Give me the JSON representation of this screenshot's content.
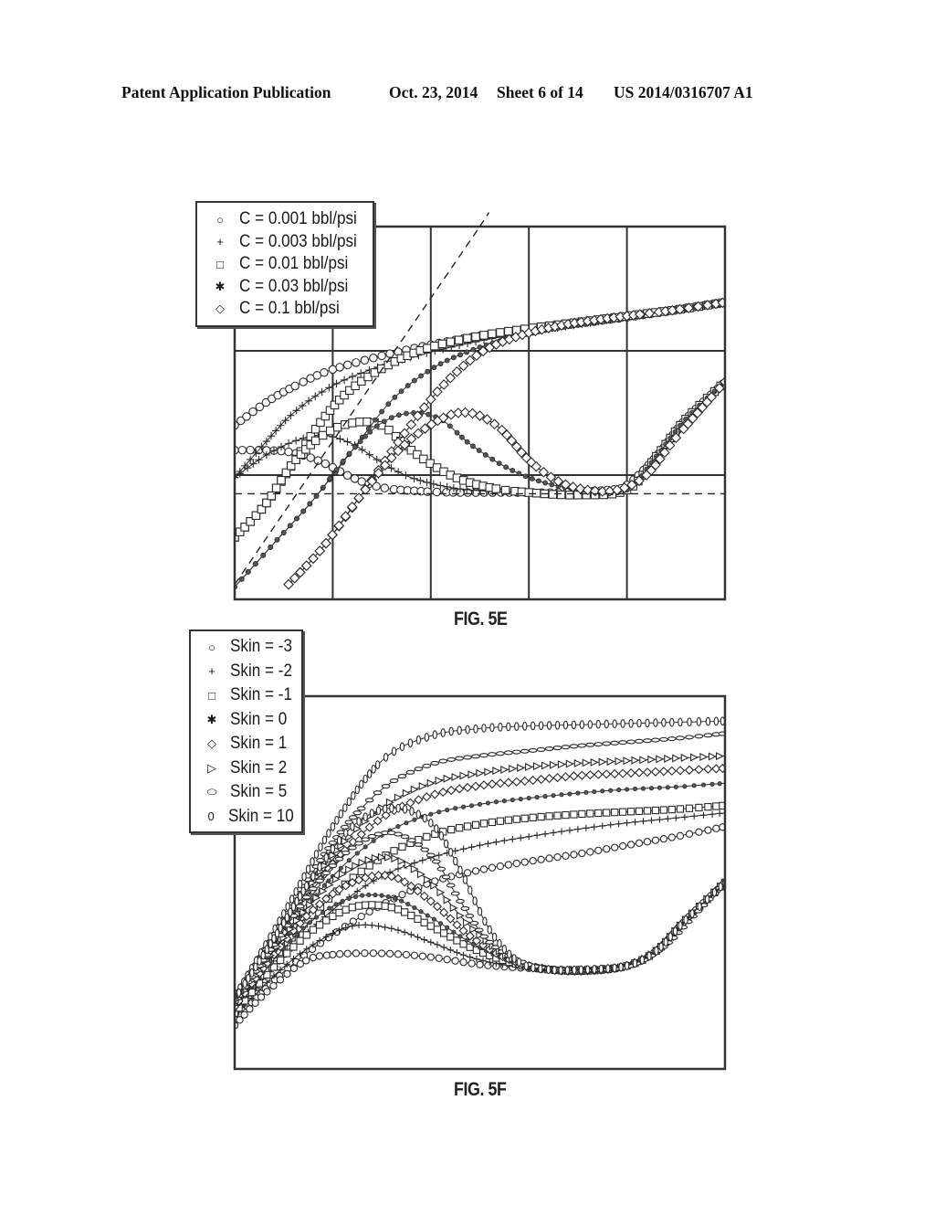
{
  "header": {
    "publication": "Patent Application Publication",
    "date": "Oct. 23, 2014",
    "sheet": "Sheet 6 of 14",
    "number": "US 2014/0316707 A1"
  },
  "figures": [
    {
      "id": "fig5e",
      "label": "FIG. 5E"
    },
    {
      "id": "fig5f",
      "label": "FIG. 5F"
    }
  ],
  "chart_data": [
    {
      "type": "line",
      "title": "FIG. 5E",
      "xlabel": "",
      "ylabel": "",
      "x_scale": "log (unlabeled decades)",
      "xlim": [
        0,
        5
      ],
      "ylim": [
        0,
        3
      ],
      "grid": true,
      "legend_position": "top-left (outside, overlapping frame)",
      "legend": [
        {
          "symbol": "circle",
          "glyph": "○",
          "label": "C = 0.001 bbl/psi"
        },
        {
          "symbol": "plus",
          "glyph": "+",
          "label": "C = 0.003 bbl/psi"
        },
        {
          "symbol": "square",
          "glyph": "□",
          "label": "C = 0.01 bbl/psi"
        },
        {
          "symbol": "asterisk",
          "glyph": "✱",
          "label": "C = 0.03 bbl/psi"
        },
        {
          "symbol": "diamond",
          "glyph": "◇",
          "label": "C = 0.1 bbl/psi"
        }
      ],
      "reference_lines": [
        {
          "name": "unit-slope",
          "style": "dashed",
          "points": [
            [
              0,
              0.12
            ],
            [
              2.5,
              3.0
            ]
          ]
        },
        {
          "name": "radial-flow-stabilization",
          "style": "dashed",
          "points": [
            [
              0.0,
              0.85
            ],
            [
              5,
              0.85
            ]
          ]
        }
      ],
      "series": [
        {
          "name": "C = 0.001 bbl/psi (pressure)",
          "marker": "circle",
          "x": [
            0,
            0.35,
            0.7,
            1.0,
            1.5,
            2.0,
            2.5,
            3.0,
            3.5,
            4.0,
            4.5,
            5.0
          ],
          "y": [
            1.4,
            1.6,
            1.75,
            1.85,
            1.96,
            2.05,
            2.12,
            2.17,
            2.22,
            2.27,
            2.33,
            2.39
          ]
        },
        {
          "name": "C = 0.001 bbl/psi (derivative)",
          "marker": "circle",
          "x": [
            0,
            0.3,
            0.6,
            0.9,
            1.2,
            1.5,
            1.9,
            2.3,
            2.8,
            3.3,
            3.8,
            4.0,
            4.3,
            4.6,
            5.0
          ],
          "y": [
            1.2,
            1.2,
            1.18,
            1.1,
            0.98,
            0.9,
            0.87,
            0.86,
            0.86,
            0.86,
            0.88,
            0.92,
            1.15,
            1.45,
            1.75
          ]
        },
        {
          "name": "C = 0.003 bbl/psi (pressure)",
          "marker": "plus",
          "x": [
            0,
            0.3,
            0.6,
            1.0,
            1.5,
            2.0,
            2.5,
            3.0,
            3.5,
            4.0,
            4.5,
            5.0
          ],
          "y": [
            0.98,
            1.25,
            1.5,
            1.72,
            1.88,
            1.99,
            2.08,
            2.15,
            2.21,
            2.27,
            2.33,
            2.39
          ]
        },
        {
          "name": "C = 0.003 bbl/psi (derivative)",
          "marker": "plus",
          "x": [
            0,
            0.3,
            0.6,
            0.9,
            1.2,
            1.5,
            1.8,
            2.2,
            2.6,
            3.0,
            3.5,
            4.0,
            4.3,
            4.6,
            5.0
          ],
          "y": [
            0.98,
            1.15,
            1.27,
            1.32,
            1.25,
            1.1,
            0.98,
            0.9,
            0.87,
            0.86,
            0.86,
            0.9,
            1.15,
            1.45,
            1.75
          ]
        },
        {
          "name": "C = 0.01 bbl/psi (pressure)",
          "marker": "square",
          "x": [
            0,
            0.3,
            0.6,
            0.9,
            1.2,
            1.6,
            2.0,
            2.5,
            3.0,
            3.5,
            4.0,
            4.5,
            5.0
          ],
          "y": [
            0.5,
            0.75,
            1.1,
            1.45,
            1.7,
            1.9,
            2.03,
            2.12,
            2.18,
            2.23,
            2.28,
            2.33,
            2.39
          ]
        },
        {
          "name": "C = 0.01 bbl/psi (derivative)",
          "marker": "square",
          "x": [
            0,
            0.3,
            0.6,
            0.9,
            1.2,
            1.5,
            1.8,
            2.2,
            2.6,
            3.0,
            3.5,
            4.0,
            4.3,
            4.6,
            5.0
          ],
          "y": [
            0.5,
            0.75,
            1.1,
            1.32,
            1.42,
            1.4,
            1.2,
            1.0,
            0.9,
            0.86,
            0.84,
            0.88,
            1.15,
            1.45,
            1.75
          ]
        },
        {
          "name": "C = 0.03 bbl/psi (pressure)",
          "marker": "asterisk",
          "x": [
            0,
            0.4,
            0.8,
            1.2,
            1.6,
            2.0,
            2.4,
            2.8,
            3.2,
            3.6,
            4.0,
            4.5,
            5.0
          ],
          "y": [
            0.1,
            0.45,
            0.8,
            1.2,
            1.6,
            1.85,
            2.0,
            2.1,
            2.17,
            2.22,
            2.27,
            2.33,
            2.39
          ]
        },
        {
          "name": "C = 0.03 bbl/psi (derivative)",
          "marker": "asterisk",
          "x": [
            0,
            0.4,
            0.8,
            1.2,
            1.5,
            1.8,
            2.1,
            2.4,
            2.8,
            3.2,
            3.6,
            4.0,
            4.3,
            4.6,
            5.0
          ],
          "y": [
            0.1,
            0.45,
            0.8,
            1.2,
            1.42,
            1.5,
            1.45,
            1.25,
            1.05,
            0.93,
            0.88,
            0.88,
            1.15,
            1.45,
            1.75
          ]
        },
        {
          "name": "C = 0.1 bbl/psi (pressure)",
          "marker": "diamond",
          "x": [
            0.55,
            0.9,
            1.3,
            1.7,
            2.1,
            2.5,
            2.9,
            3.3,
            3.7,
            4.1,
            4.5,
            5.0
          ],
          "y": [
            0.12,
            0.42,
            0.85,
            1.3,
            1.7,
            1.98,
            2.12,
            2.2,
            2.25,
            2.29,
            2.33,
            2.39
          ]
        },
        {
          "name": "C = 0.1 bbl/psi (derivative)",
          "marker": "diamond",
          "x": [
            0.55,
            0.9,
            1.3,
            1.7,
            2.1,
            2.4,
            2.7,
            3.0,
            3.3,
            3.6,
            3.9,
            4.2,
            4.5,
            5.0
          ],
          "y": [
            0.12,
            0.42,
            0.85,
            1.22,
            1.45,
            1.5,
            1.38,
            1.12,
            0.95,
            0.88,
            0.88,
            1.0,
            1.3,
            1.75
          ]
        }
      ]
    },
    {
      "type": "line",
      "title": "FIG. 5F",
      "xlabel": "",
      "ylabel": "",
      "x_scale": "log (unlabeled decades)",
      "xlim": [
        0,
        5
      ],
      "ylim": [
        0,
        3
      ],
      "grid": false,
      "legend_position": "top-left (outside, overlapping frame)",
      "legend": [
        {
          "symbol": "circle",
          "glyph": "○",
          "label": "Skin = -3"
        },
        {
          "symbol": "plus",
          "glyph": "+",
          "label": "Skin = -2"
        },
        {
          "symbol": "square",
          "glyph": "□",
          "label": "Skin = -1"
        },
        {
          "symbol": "asterisk",
          "glyph": "✱",
          "label": "Skin = 0"
        },
        {
          "symbol": "diamond",
          "glyph": "◇",
          "label": "Skin = 1"
        },
        {
          "symbol": "triangle-right",
          "glyph": "▷",
          "label": "Skin = 2"
        },
        {
          "symbol": "ellipse-horizontal",
          "glyph": "⬭",
          "label": "Skin = 5"
        },
        {
          "symbol": "ellipse-vertical",
          "glyph": "0",
          "label": "Skin = 10"
        }
      ],
      "series": [
        {
          "name": "Skin = -3 (pressure)",
          "marker": "circle",
          "x": [
            0,
            0.5,
            1.0,
            1.5,
            2.0,
            2.5,
            3.0,
            3.5,
            4.0,
            4.5,
            5.0
          ],
          "y": [
            0.4,
            0.78,
            1.08,
            1.32,
            1.5,
            1.6,
            1.67,
            1.73,
            1.8,
            1.87,
            1.95
          ]
        },
        {
          "name": "Skin = -3 (derivative)",
          "marker": "circle",
          "x": [
            0,
            0.3,
            0.7,
            1.0,
            1.5,
            2.0,
            2.5,
            3.0,
            3.5,
            4.0,
            4.3,
            4.6,
            5.0
          ],
          "y": [
            0.35,
            0.6,
            0.86,
            0.92,
            0.93,
            0.9,
            0.84,
            0.81,
            0.8,
            0.83,
            0.95,
            1.2,
            1.5
          ]
        },
        {
          "name": "Skin = -2 (pressure)",
          "marker": "plus",
          "x": [
            0,
            0.5,
            1.0,
            1.5,
            2.0,
            2.5,
            3.0,
            3.5,
            4.0,
            4.5,
            5.0
          ],
          "y": [
            0.45,
            0.9,
            1.28,
            1.55,
            1.7,
            1.8,
            1.87,
            1.93,
            1.98,
            2.02,
            2.06
          ]
        },
        {
          "name": "Skin = -2 (derivative)",
          "marker": "plus",
          "x": [
            0,
            0.4,
            0.8,
            1.2,
            1.6,
            2.0,
            2.4,
            2.8,
            3.2,
            3.6,
            4.0,
            4.3,
            4.6,
            5.0
          ],
          "y": [
            0.42,
            0.75,
            1.0,
            1.15,
            1.13,
            1.02,
            0.9,
            0.83,
            0.8,
            0.79,
            0.83,
            0.95,
            1.2,
            1.5
          ]
        },
        {
          "name": "Skin = -1 (pressure)",
          "marker": "square",
          "x": [
            0,
            0.5,
            1.0,
            1.5,
            2.0,
            2.5,
            3.0,
            3.5,
            4.0,
            4.5,
            5.0
          ],
          "y": [
            0.48,
            0.98,
            1.4,
            1.7,
            1.88,
            1.97,
            2.02,
            2.05,
            2.07,
            2.09,
            2.12
          ]
        },
        {
          "name": "Skin = -1 (derivative)",
          "marker": "square",
          "x": [
            0,
            0.4,
            0.8,
            1.2,
            1.6,
            2.0,
            2.4,
            2.8,
            3.2,
            3.6,
            4.0,
            4.3,
            4.6,
            5.0
          ],
          "y": [
            0.45,
            0.82,
            1.12,
            1.3,
            1.3,
            1.15,
            0.98,
            0.86,
            0.8,
            0.79,
            0.83,
            0.95,
            1.2,
            1.5
          ]
        },
        {
          "name": "Skin = 0 (pressure)",
          "marker": "asterisk",
          "x": [
            0,
            0.5,
            1.0,
            1.5,
            2.0,
            2.5,
            3.0,
            3.5,
            4.0,
            4.5,
            5.0
          ],
          "y": [
            0.5,
            1.05,
            1.55,
            1.88,
            2.05,
            2.13,
            2.18,
            2.22,
            2.25,
            2.27,
            2.3
          ]
        },
        {
          "name": "Skin = 0 (derivative)",
          "marker": "asterisk",
          "x": [
            0,
            0.4,
            0.8,
            1.2,
            1.6,
            2.0,
            2.4,
            2.8,
            3.2,
            3.6,
            4.0,
            4.3,
            4.6,
            5.0
          ],
          "y": [
            0.48,
            0.88,
            1.2,
            1.38,
            1.38,
            1.22,
            1.02,
            0.87,
            0.8,
            0.79,
            0.83,
            0.95,
            1.2,
            1.5
          ]
        },
        {
          "name": "Skin = 1 (pressure)",
          "marker": "diamond",
          "x": [
            0,
            0.5,
            1.0,
            1.5,
            2.0,
            2.5,
            3.0,
            3.5,
            4.0,
            4.5,
            5.0
          ],
          "y": [
            0.52,
            1.1,
            1.65,
            2.02,
            2.2,
            2.28,
            2.32,
            2.36,
            2.38,
            2.4,
            2.42
          ]
        },
        {
          "name": "Skin = 1 (derivative)",
          "marker": "diamond",
          "x": [
            0,
            0.4,
            0.8,
            1.2,
            1.6,
            2.0,
            2.4,
            2.8,
            3.2,
            3.6,
            4.0,
            4.3,
            4.6,
            5.0
          ],
          "y": [
            0.5,
            0.92,
            1.28,
            1.5,
            1.55,
            1.35,
            1.07,
            0.88,
            0.8,
            0.79,
            0.83,
            0.95,
            1.2,
            1.5
          ]
        },
        {
          "name": "Skin = 2 (pressure)",
          "marker": "triangle-right",
          "x": [
            0,
            0.5,
            1.0,
            1.5,
            2.0,
            2.5,
            3.0,
            3.5,
            4.0,
            4.5,
            5.0
          ],
          "y": [
            0.54,
            1.15,
            1.72,
            2.1,
            2.3,
            2.38,
            2.43,
            2.46,
            2.48,
            2.5,
            2.52
          ]
        },
        {
          "name": "Skin = 2 (derivative)",
          "marker": "triangle-right",
          "x": [
            0,
            0.4,
            0.8,
            1.2,
            1.6,
            2.0,
            2.4,
            2.8,
            3.2,
            3.6,
            4.0,
            4.3,
            4.6,
            5.0
          ],
          "y": [
            0.52,
            0.95,
            1.35,
            1.62,
            1.7,
            1.5,
            1.15,
            0.9,
            0.81,
            0.79,
            0.83,
            0.95,
            1.2,
            1.5
          ]
        },
        {
          "name": "Skin = 5 (pressure)",
          "marker": "ellipse-horizontal",
          "x": [
            0,
            0.5,
            1.0,
            1.5,
            2.0,
            2.5,
            3.0,
            3.5,
            4.0,
            4.5,
            5.0
          ],
          "y": [
            0.56,
            1.2,
            1.82,
            2.25,
            2.45,
            2.52,
            2.56,
            2.6,
            2.63,
            2.66,
            2.7
          ]
        },
        {
          "name": "Skin = 5 (derivative)",
          "marker": "ellipse-horizontal",
          "x": [
            0,
            0.4,
            0.8,
            1.2,
            1.6,
            2.0,
            2.3,
            2.6,
            3.0,
            3.4,
            3.8,
            4.1,
            4.4,
            4.7,
            5.0
          ],
          "y": [
            0.54,
            1.0,
            1.45,
            1.78,
            1.9,
            1.72,
            1.35,
            1.02,
            0.84,
            0.8,
            0.8,
            0.85,
            1.0,
            1.25,
            1.5
          ]
        },
        {
          "name": "Skin = 10 (pressure)",
          "marker": "ellipse-vertical",
          "x": [
            0,
            0.5,
            1.0,
            1.5,
            2.0,
            2.5,
            3.0,
            3.5,
            4.0,
            4.5,
            5.0
          ],
          "y": [
            0.58,
            1.25,
            1.95,
            2.48,
            2.68,
            2.74,
            2.76,
            2.77,
            2.78,
            2.79,
            2.8
          ]
        },
        {
          "name": "Skin = 10 (derivative)",
          "marker": "ellipse-vertical",
          "x": [
            0,
            0.4,
            0.8,
            1.2,
            1.6,
            2.0,
            2.3,
            2.6,
            2.9,
            3.2,
            3.6,
            4.0,
            4.3,
            4.6,
            5.0
          ],
          "y": [
            0.56,
            1.05,
            1.55,
            1.95,
            2.1,
            1.98,
            1.6,
            1.12,
            0.86,
            0.8,
            0.8,
            0.83,
            0.95,
            1.2,
            1.5
          ]
        }
      ]
    }
  ]
}
